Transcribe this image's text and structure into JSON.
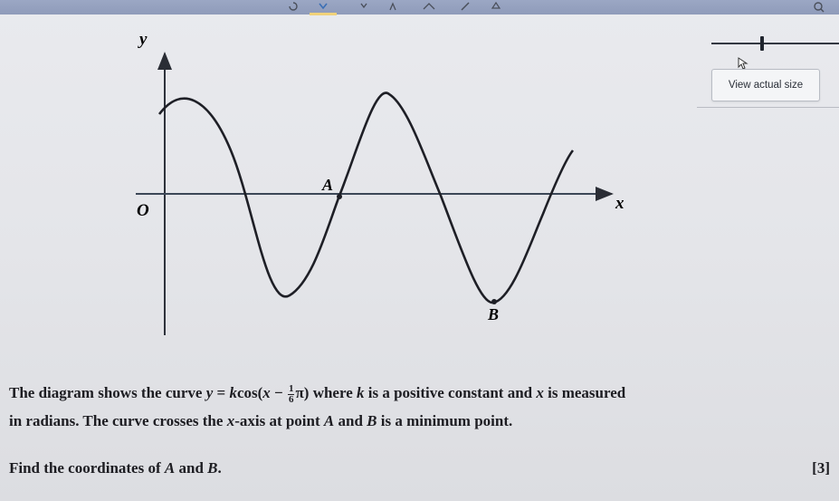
{
  "diagram": {
    "y_label": "y",
    "x_label": "x",
    "origin_label": "O",
    "point_a_label": "A",
    "point_b_label": "B"
  },
  "viewer": {
    "view_actual_size_label": "View actual size"
  },
  "question": {
    "line1_prefix": "The diagram shows the curve ",
    "eq_y": "y",
    "eq_equals": " = ",
    "eq_k": "k",
    "eq_cos_open": "cos(",
    "eq_x": "x",
    "eq_minus": " − ",
    "frac_num": "1",
    "frac_den": "6",
    "eq_pi_close": "π)",
    "line1_mid": " where ",
    "var_k": "k",
    "line1_mid2": " is a positive constant and ",
    "var_x": "x",
    "line1_suffix": " is measured",
    "line2_prefix": "in radians. The curve crosses the ",
    "line2_x": "x",
    "line2_mid": "-axis at point ",
    "line2_a": "A",
    "line2_mid2": " and ",
    "line2_b": "B",
    "line2_suffix": " is a minimum point.",
    "find_prefix": "Find the coordinates of ",
    "find_a": "A",
    "find_and": " and ",
    "find_b": "B",
    "find_suffix": ".",
    "marks": "[3]"
  },
  "colors": {
    "topbar": "#9ba7c4",
    "curve": "#1e1f26",
    "background": "#e6e7eb"
  }
}
